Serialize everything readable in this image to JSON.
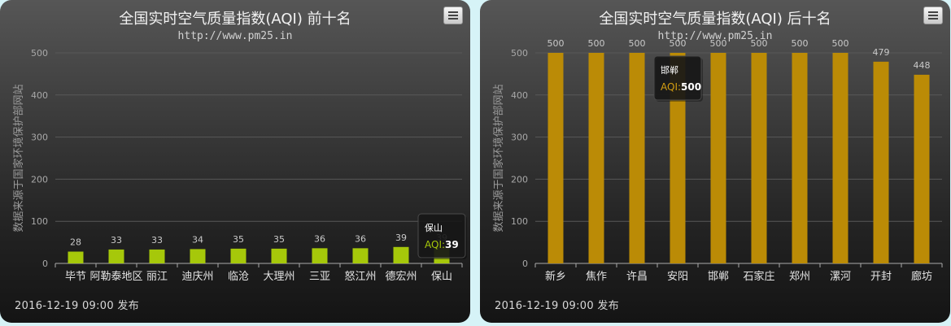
{
  "chart_data": [
    {
      "type": "bar",
      "title": "全国实时空气质量指数(AQI) 前十名",
      "subtitle": "http://www.pm25.in",
      "ylabel": "数据来源于国家环境保护部网站",
      "categories": [
        "毕节",
        "阿勒泰地区",
        "丽江",
        "迪庆州",
        "临沧",
        "大理州",
        "三亚",
        "怒江州",
        "德宏州",
        "保山"
      ],
      "values": [
        28,
        33,
        33,
        34,
        35,
        35,
        36,
        36,
        39,
        39
      ],
      "ylim": [
        0,
        500
      ],
      "yticks": [
        "0",
        "100",
        "200",
        "300",
        "400",
        "500"
      ],
      "bar_color": "#a6c80a",
      "tooltip": {
        "name": "保山",
        "label": "AQI:",
        "value": "39",
        "label_color": "#a6c80a"
      },
      "footer": "2016-12-19 09:00 发布"
    },
    {
      "type": "bar",
      "title": "全国实时空气质量指数(AQI) 后十名",
      "subtitle": "http://www.pm25.in",
      "ylabel": "数据来源于国家环境保护部网站",
      "categories": [
        "新乡",
        "焦作",
        "许昌",
        "安阳",
        "邯郸",
        "石家庄",
        "郑州",
        "漯河",
        "开封",
        "廊坊"
      ],
      "values": [
        500,
        500,
        500,
        500,
        500,
        500,
        500,
        500,
        479,
        448
      ],
      "ylim": [
        0,
        500
      ],
      "yticks": [
        "0",
        "100",
        "200",
        "300",
        "400",
        "500"
      ],
      "bar_color": "#bb8b06",
      "tooltip": {
        "name": "邯郸",
        "label": "AQI:",
        "value": "500",
        "label_color": "#d49e12"
      },
      "footer": "2016-12-19 09:00 发布"
    }
  ]
}
